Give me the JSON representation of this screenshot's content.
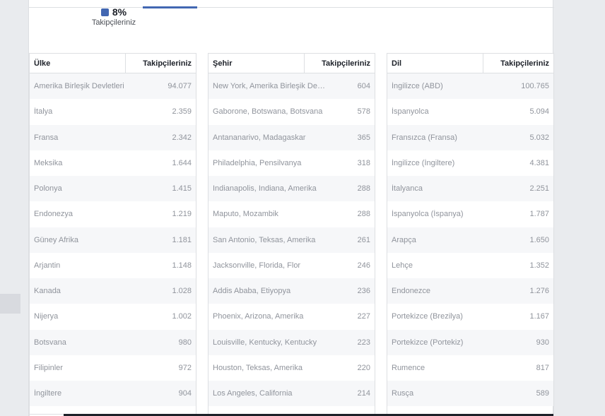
{
  "legend": {
    "value": "8%",
    "label": "Takipçileriniz",
    "color": "#4267b2"
  },
  "tables": [
    {
      "header": {
        "name": "Ülke",
        "value": "Takipçileriniz"
      },
      "rows": [
        {
          "name": "Amerika Birleşik Devletleri",
          "value": "94.077"
        },
        {
          "name": "İtalya",
          "value": "2.359"
        },
        {
          "name": "Fransa",
          "value": "2.342"
        },
        {
          "name": "Meksika",
          "value": "1.644"
        },
        {
          "name": "Polonya",
          "value": "1.415"
        },
        {
          "name": "Endonezya",
          "value": "1.219"
        },
        {
          "name": "Güney Afrika",
          "value": "1.181"
        },
        {
          "name": "Arjantin",
          "value": "1.148"
        },
        {
          "name": "Kanada",
          "value": "1.028"
        },
        {
          "name": "Nijerya",
          "value": "1.002"
        },
        {
          "name": "Botsvana",
          "value": "980"
        },
        {
          "name": "Filipinler",
          "value": "972"
        },
        {
          "name": "İngiltere",
          "value": "904"
        }
      ]
    },
    {
      "header": {
        "name": "Şehir",
        "value": "Takipçileriniz"
      },
      "rows": [
        {
          "name": "New York, Amerika Birleşik Devletleri",
          "value": "604"
        },
        {
          "name": "Gaborone, Botswana, Botsvana",
          "value": "578"
        },
        {
          "name": "Antananarivo, Madagaskar",
          "value": "365"
        },
        {
          "name": "Philadelphia, Pensilvanya",
          "value": "318"
        },
        {
          "name": "Indianapolis, Indiana, Amerika",
          "value": "288"
        },
        {
          "name": "Maputo, Mozambik",
          "value": "288"
        },
        {
          "name": "San Antonio, Teksas, Amerika",
          "value": "261"
        },
        {
          "name": "Jacksonville, Florida, Flor",
          "value": "246"
        },
        {
          "name": "Addis Ababa, Etiyopya",
          "value": "236"
        },
        {
          "name": "Phoenix, Arizona, Amerika",
          "value": "227"
        },
        {
          "name": "Louisville, Kentucky, Kentucky",
          "value": "223"
        },
        {
          "name": "Houston, Teksas, Amerika",
          "value": "220"
        },
        {
          "name": "Los Angeles, California",
          "value": "214"
        }
      ]
    },
    {
      "header": {
        "name": "Dil",
        "value": "Takipçileriniz"
      },
      "rows": [
        {
          "name": "İngilizce (ABD)",
          "value": "100.765"
        },
        {
          "name": "İspanyolca",
          "value": "5.094"
        },
        {
          "name": "Fransızca (Fransa)",
          "value": "5.032"
        },
        {
          "name": "İngilizce (İngiltere)",
          "value": "4.381"
        },
        {
          "name": "İtalyanca",
          "value": "2.251"
        },
        {
          "name": "İspanyolca (İspanya)",
          "value": "1.787"
        },
        {
          "name": "Arapça",
          "value": "1.650"
        },
        {
          "name": "Lehçe",
          "value": "1.352"
        },
        {
          "name": "Endonezce",
          "value": "1.276"
        },
        {
          "name": "Portekizce (Brezilya)",
          "value": "1.167"
        },
        {
          "name": "Portekizce (Portekiz)",
          "value": "930"
        },
        {
          "name": "Rumence",
          "value": "817"
        },
        {
          "name": "Rusça",
          "value": "589"
        }
      ]
    }
  ]
}
